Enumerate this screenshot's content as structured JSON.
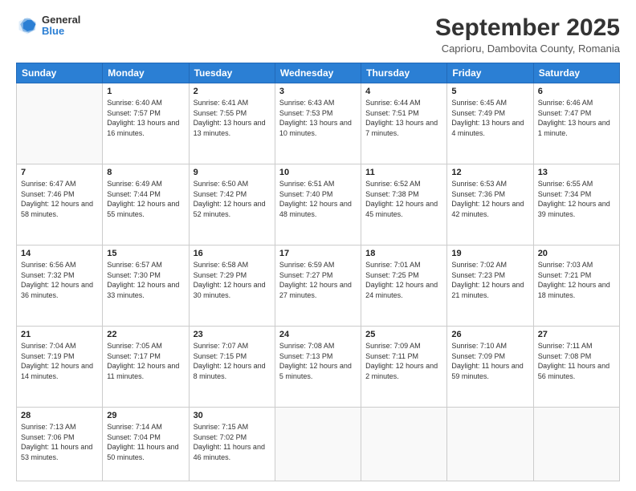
{
  "header": {
    "logo": {
      "general": "General",
      "blue": "Blue"
    },
    "title": "September 2025",
    "subtitle": "Caprioru, Dambovita County, Romania"
  },
  "days_of_week": [
    "Sunday",
    "Monday",
    "Tuesday",
    "Wednesday",
    "Thursday",
    "Friday",
    "Saturday"
  ],
  "weeks": [
    [
      {
        "day": "",
        "sunrise": "",
        "sunset": "",
        "daylight": ""
      },
      {
        "day": "1",
        "sunrise": "Sunrise: 6:40 AM",
        "sunset": "Sunset: 7:57 PM",
        "daylight": "Daylight: 13 hours and 16 minutes."
      },
      {
        "day": "2",
        "sunrise": "Sunrise: 6:41 AM",
        "sunset": "Sunset: 7:55 PM",
        "daylight": "Daylight: 13 hours and 13 minutes."
      },
      {
        "day": "3",
        "sunrise": "Sunrise: 6:43 AM",
        "sunset": "Sunset: 7:53 PM",
        "daylight": "Daylight: 13 hours and 10 minutes."
      },
      {
        "day": "4",
        "sunrise": "Sunrise: 6:44 AM",
        "sunset": "Sunset: 7:51 PM",
        "daylight": "Daylight: 13 hours and 7 minutes."
      },
      {
        "day": "5",
        "sunrise": "Sunrise: 6:45 AM",
        "sunset": "Sunset: 7:49 PM",
        "daylight": "Daylight: 13 hours and 4 minutes."
      },
      {
        "day": "6",
        "sunrise": "Sunrise: 6:46 AM",
        "sunset": "Sunset: 7:47 PM",
        "daylight": "Daylight: 13 hours and 1 minute."
      }
    ],
    [
      {
        "day": "7",
        "sunrise": "Sunrise: 6:47 AM",
        "sunset": "Sunset: 7:46 PM",
        "daylight": "Daylight: 12 hours and 58 minutes."
      },
      {
        "day": "8",
        "sunrise": "Sunrise: 6:49 AM",
        "sunset": "Sunset: 7:44 PM",
        "daylight": "Daylight: 12 hours and 55 minutes."
      },
      {
        "day": "9",
        "sunrise": "Sunrise: 6:50 AM",
        "sunset": "Sunset: 7:42 PM",
        "daylight": "Daylight: 12 hours and 52 minutes."
      },
      {
        "day": "10",
        "sunrise": "Sunrise: 6:51 AM",
        "sunset": "Sunset: 7:40 PM",
        "daylight": "Daylight: 12 hours and 48 minutes."
      },
      {
        "day": "11",
        "sunrise": "Sunrise: 6:52 AM",
        "sunset": "Sunset: 7:38 PM",
        "daylight": "Daylight: 12 hours and 45 minutes."
      },
      {
        "day": "12",
        "sunrise": "Sunrise: 6:53 AM",
        "sunset": "Sunset: 7:36 PM",
        "daylight": "Daylight: 12 hours and 42 minutes."
      },
      {
        "day": "13",
        "sunrise": "Sunrise: 6:55 AM",
        "sunset": "Sunset: 7:34 PM",
        "daylight": "Daylight: 12 hours and 39 minutes."
      }
    ],
    [
      {
        "day": "14",
        "sunrise": "Sunrise: 6:56 AM",
        "sunset": "Sunset: 7:32 PM",
        "daylight": "Daylight: 12 hours and 36 minutes."
      },
      {
        "day": "15",
        "sunrise": "Sunrise: 6:57 AM",
        "sunset": "Sunset: 7:30 PM",
        "daylight": "Daylight: 12 hours and 33 minutes."
      },
      {
        "day": "16",
        "sunrise": "Sunrise: 6:58 AM",
        "sunset": "Sunset: 7:29 PM",
        "daylight": "Daylight: 12 hours and 30 minutes."
      },
      {
        "day": "17",
        "sunrise": "Sunrise: 6:59 AM",
        "sunset": "Sunset: 7:27 PM",
        "daylight": "Daylight: 12 hours and 27 minutes."
      },
      {
        "day": "18",
        "sunrise": "Sunrise: 7:01 AM",
        "sunset": "Sunset: 7:25 PM",
        "daylight": "Daylight: 12 hours and 24 minutes."
      },
      {
        "day": "19",
        "sunrise": "Sunrise: 7:02 AM",
        "sunset": "Sunset: 7:23 PM",
        "daylight": "Daylight: 12 hours and 21 minutes."
      },
      {
        "day": "20",
        "sunrise": "Sunrise: 7:03 AM",
        "sunset": "Sunset: 7:21 PM",
        "daylight": "Daylight: 12 hours and 18 minutes."
      }
    ],
    [
      {
        "day": "21",
        "sunrise": "Sunrise: 7:04 AM",
        "sunset": "Sunset: 7:19 PM",
        "daylight": "Daylight: 12 hours and 14 minutes."
      },
      {
        "day": "22",
        "sunrise": "Sunrise: 7:05 AM",
        "sunset": "Sunset: 7:17 PM",
        "daylight": "Daylight: 12 hours and 11 minutes."
      },
      {
        "day": "23",
        "sunrise": "Sunrise: 7:07 AM",
        "sunset": "Sunset: 7:15 PM",
        "daylight": "Daylight: 12 hours and 8 minutes."
      },
      {
        "day": "24",
        "sunrise": "Sunrise: 7:08 AM",
        "sunset": "Sunset: 7:13 PM",
        "daylight": "Daylight: 12 hours and 5 minutes."
      },
      {
        "day": "25",
        "sunrise": "Sunrise: 7:09 AM",
        "sunset": "Sunset: 7:11 PM",
        "daylight": "Daylight: 12 hours and 2 minutes."
      },
      {
        "day": "26",
        "sunrise": "Sunrise: 7:10 AM",
        "sunset": "Sunset: 7:09 PM",
        "daylight": "Daylight: 11 hours and 59 minutes."
      },
      {
        "day": "27",
        "sunrise": "Sunrise: 7:11 AM",
        "sunset": "Sunset: 7:08 PM",
        "daylight": "Daylight: 11 hours and 56 minutes."
      }
    ],
    [
      {
        "day": "28",
        "sunrise": "Sunrise: 7:13 AM",
        "sunset": "Sunset: 7:06 PM",
        "daylight": "Daylight: 11 hours and 53 minutes."
      },
      {
        "day": "29",
        "sunrise": "Sunrise: 7:14 AM",
        "sunset": "Sunset: 7:04 PM",
        "daylight": "Daylight: 11 hours and 50 minutes."
      },
      {
        "day": "30",
        "sunrise": "Sunrise: 7:15 AM",
        "sunset": "Sunset: 7:02 PM",
        "daylight": "Daylight: 11 hours and 46 minutes."
      },
      {
        "day": "",
        "sunrise": "",
        "sunset": "",
        "daylight": ""
      },
      {
        "day": "",
        "sunrise": "",
        "sunset": "",
        "daylight": ""
      },
      {
        "day": "",
        "sunrise": "",
        "sunset": "",
        "daylight": ""
      },
      {
        "day": "",
        "sunrise": "",
        "sunset": "",
        "daylight": ""
      }
    ]
  ]
}
